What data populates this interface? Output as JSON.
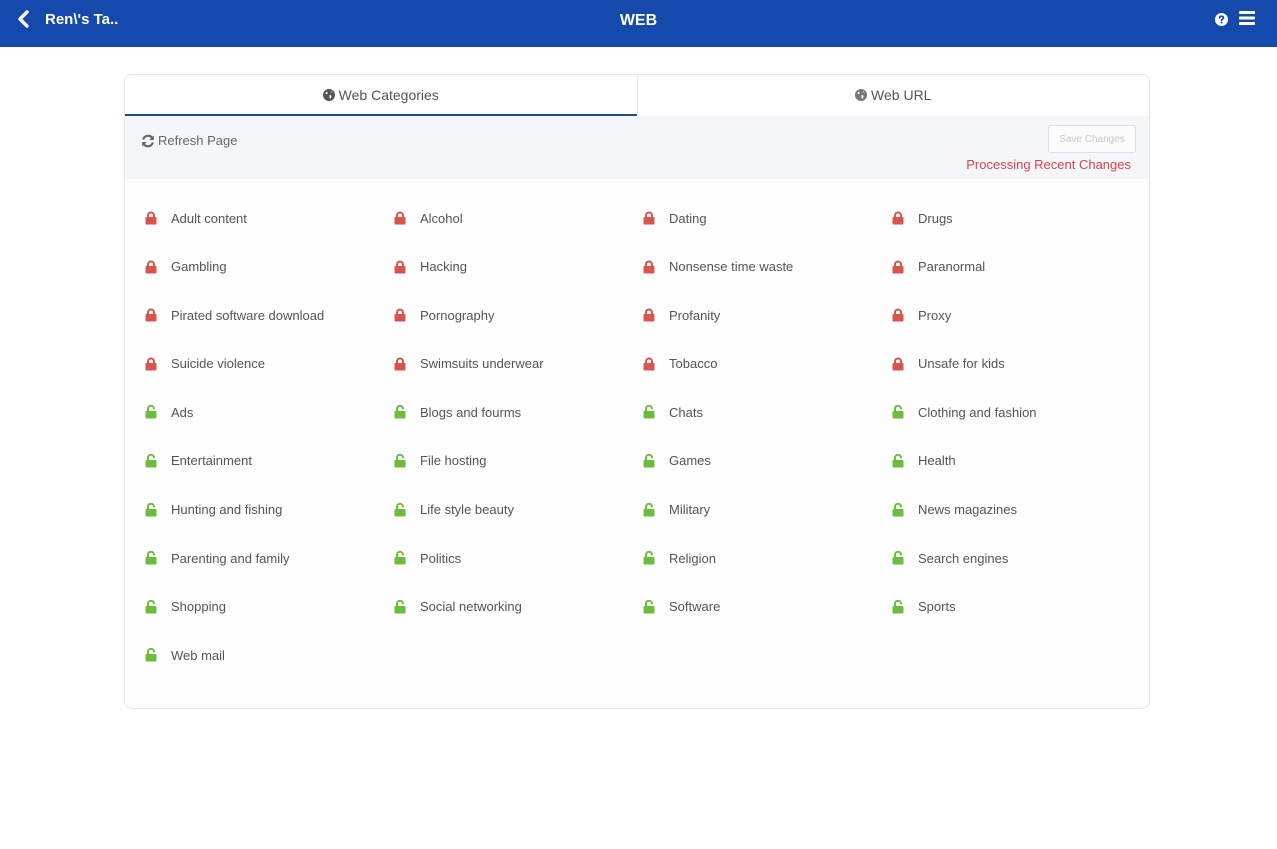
{
  "header": {
    "back_label": "Ren\\'s Ta..",
    "title": "WEB",
    "icons": [
      "chevron-left-icon",
      "help-icon",
      "hamburger-menu-icon"
    ],
    "color": "#1549ab"
  },
  "tabs": [
    {
      "label": "Web Categories",
      "icon": "globe-icon",
      "active": true
    },
    {
      "label": "Web URL",
      "icon": "globe-icon",
      "active": false
    }
  ],
  "toolbar": {
    "refresh_label": "Refresh Page",
    "save_label": "Save Changes",
    "status_text": "Processing Recent Changes"
  },
  "colors": {
    "blocked": "#d9534f",
    "allowed": "#6cbd3c",
    "status": "#d9454a"
  },
  "categories": [
    {
      "label": "Adult content",
      "blocked": true
    },
    {
      "label": "Alcohol",
      "blocked": true
    },
    {
      "label": "Dating",
      "blocked": true
    },
    {
      "label": "Drugs",
      "blocked": true
    },
    {
      "label": "Gambling",
      "blocked": true
    },
    {
      "label": "Hacking",
      "blocked": true
    },
    {
      "label": "Nonsense time waste",
      "blocked": true
    },
    {
      "label": "Paranormal",
      "blocked": true
    },
    {
      "label": "Pirated software download",
      "blocked": true
    },
    {
      "label": "Pornography",
      "blocked": true
    },
    {
      "label": "Profanity",
      "blocked": true
    },
    {
      "label": "Proxy",
      "blocked": true
    },
    {
      "label": "Suicide violence",
      "blocked": true
    },
    {
      "label": "Swimsuits underwear",
      "blocked": true
    },
    {
      "label": "Tobacco",
      "blocked": true
    },
    {
      "label": "Unsafe for kids",
      "blocked": true
    },
    {
      "label": "Ads",
      "blocked": false
    },
    {
      "label": "Blogs and fourms",
      "blocked": false
    },
    {
      "label": "Chats",
      "blocked": false
    },
    {
      "label": "Clothing and fashion",
      "blocked": false
    },
    {
      "label": "Entertainment",
      "blocked": false
    },
    {
      "label": "File hosting",
      "blocked": false
    },
    {
      "label": "Games",
      "blocked": false
    },
    {
      "label": "Health",
      "blocked": false
    },
    {
      "label": "Hunting and fishing",
      "blocked": false
    },
    {
      "label": "Life style beauty",
      "blocked": false
    },
    {
      "label": "Military",
      "blocked": false
    },
    {
      "label": "News magazines",
      "blocked": false
    },
    {
      "label": "Parenting and family",
      "blocked": false
    },
    {
      "label": "Politics",
      "blocked": false
    },
    {
      "label": "Religion",
      "blocked": false
    },
    {
      "label": "Search engines",
      "blocked": false
    },
    {
      "label": "Shopping",
      "blocked": false
    },
    {
      "label": "Social networking",
      "blocked": false
    },
    {
      "label": "Software",
      "blocked": false
    },
    {
      "label": "Sports",
      "blocked": false
    },
    {
      "label": "Web mail",
      "blocked": false
    }
  ]
}
